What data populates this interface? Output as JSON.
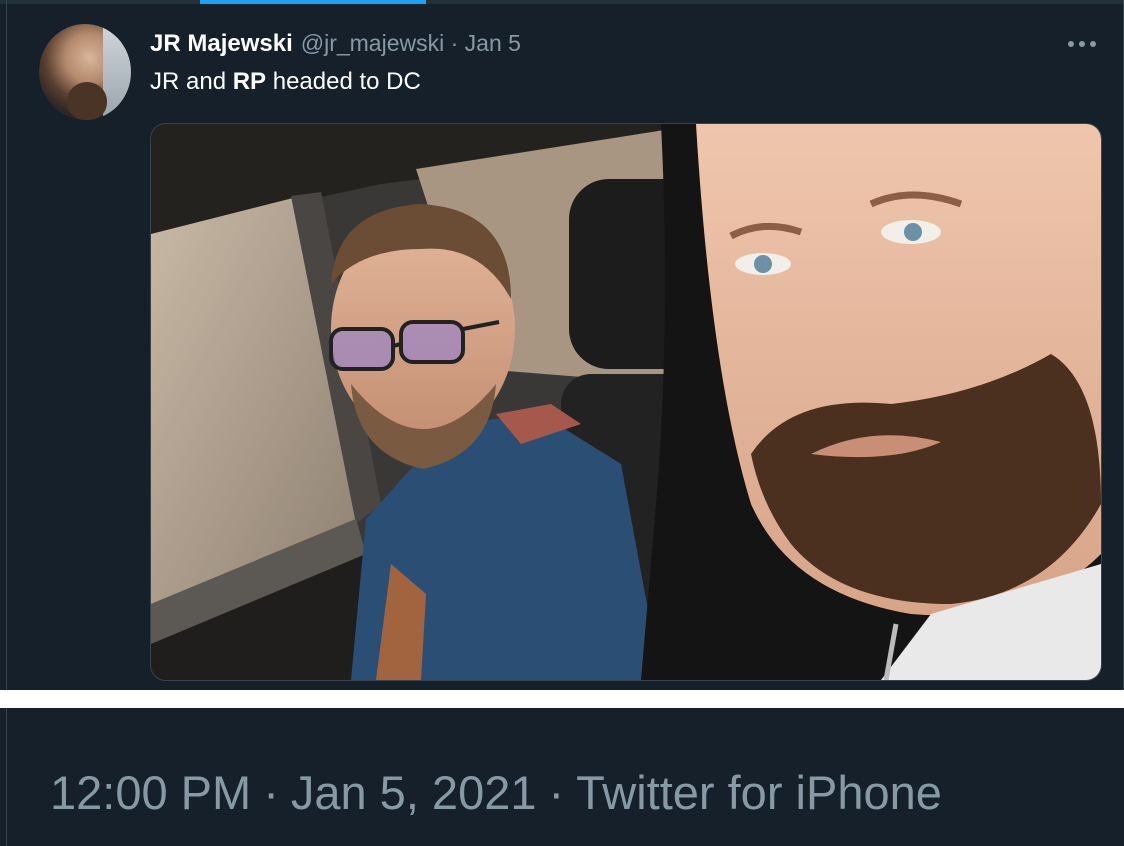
{
  "tweet": {
    "display_name": "JR Majewski",
    "handle": "@jr_majewski",
    "separator": "·",
    "date": "Jan 5",
    "text_part1": "JR and ",
    "text_bold": "RP",
    "text_part2": " headed to DC",
    "more_icon": "more-horizontal-icon",
    "photo_alt": "Two men seated in a car; the man in the foreground wears a black hoodie, the man behind wears glasses and a blue jacket"
  },
  "footer": {
    "time": "12:00 PM",
    "separator": "·",
    "full_date": "Jan 5, 2021",
    "separator2": "·",
    "source": "Twitter for iPhone"
  },
  "colors": {
    "background": "#15202b",
    "text_primary": "#ffffff",
    "text_secondary": "#8899a6",
    "accent": "#1da1f2",
    "border": "#38444d"
  }
}
